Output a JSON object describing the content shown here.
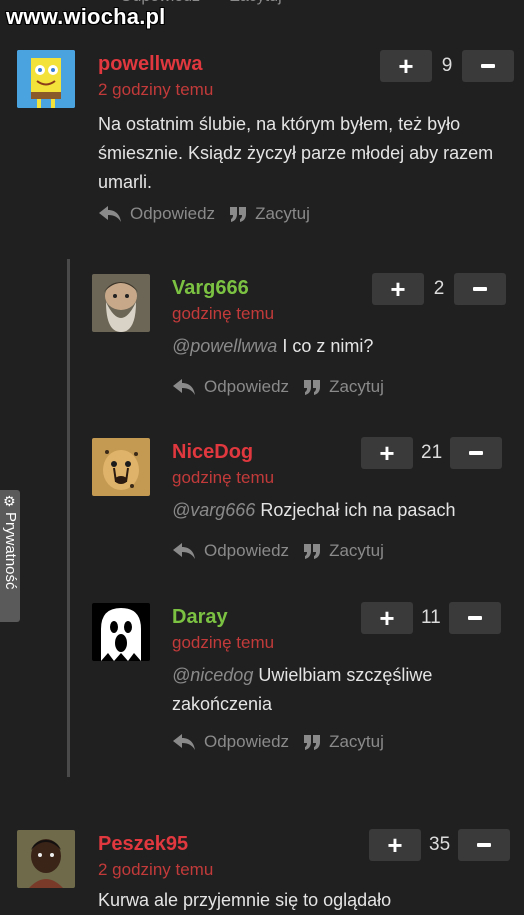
{
  "watermark": "www.wiocha.pl",
  "actions": {
    "reply": "Odpowiedz",
    "quote": "Zacytuj"
  },
  "privacy": {
    "label": "Prywatność"
  },
  "comments": [
    {
      "author": "powellwwa",
      "time": "2 godziny temu",
      "score": "9",
      "mention": "",
      "text": "Na ostatnim ślubie, na którym byłem, też było śmiesznie. Ksiądz życzył parze młodej aby razem umarli."
    },
    {
      "author": "Varg666",
      "time": "godzinę temu",
      "score": "2",
      "mention": "@powellwwa",
      "text": "I co z nimi?"
    },
    {
      "author": "NiceDog",
      "time": "godzinę temu",
      "score": "21",
      "mention": "@varg666",
      "text": "Rozjechał ich na pasach"
    },
    {
      "author": "Daray",
      "time": "godzinę temu",
      "score": "11",
      "mention": "@nicedog",
      "text": "Uwielbiam szczęśliwe zakończenia"
    },
    {
      "author": "Peszek95",
      "time": "2 godziny temu",
      "score": "35",
      "mention": "",
      "text": "Kurwa ale przyjemnie się to oglądało"
    }
  ]
}
